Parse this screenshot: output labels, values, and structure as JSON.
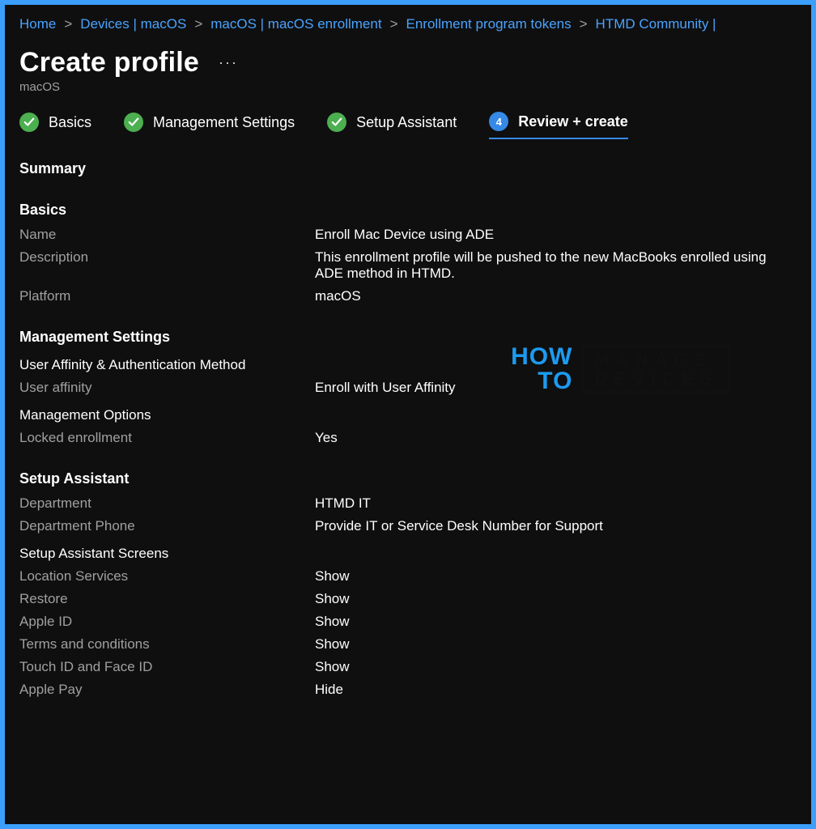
{
  "breadcrumb": [
    {
      "label": "Home"
    },
    {
      "label": "Devices | macOS"
    },
    {
      "label": "macOS | macOS enrollment"
    },
    {
      "label": "Enrollment program tokens"
    },
    {
      "label": "HTMD Community |"
    }
  ],
  "header": {
    "title": "Create profile",
    "subtitle": "macOS",
    "more": "···"
  },
  "steps": [
    {
      "label": "Basics",
      "state": "done"
    },
    {
      "label": "Management Settings",
      "state": "done"
    },
    {
      "label": "Setup Assistant",
      "state": "done"
    },
    {
      "label": "Review + create",
      "state": "active",
      "num": "4"
    }
  ],
  "summary_heading": "Summary",
  "sections": {
    "basics": {
      "heading": "Basics",
      "rows": [
        {
          "k": "Name",
          "v": "Enroll Mac Device using ADE"
        },
        {
          "k": "Description",
          "v": "This enrollment profile will be pushed to the new MacBooks enrolled using ADE method in HTMD."
        },
        {
          "k": "Platform",
          "v": "macOS"
        }
      ]
    },
    "mgmt": {
      "heading": "Management Settings",
      "sub1": "User Affinity & Authentication Method",
      "rows1": [
        {
          "k": "User affinity",
          "v": "Enroll with User Affinity"
        }
      ],
      "sub2": "Management Options",
      "rows2": [
        {
          "k": "Locked enrollment",
          "v": "Yes"
        }
      ]
    },
    "setup": {
      "heading": "Setup Assistant",
      "rows1": [
        {
          "k": "Department",
          "v": "HTMD IT"
        },
        {
          "k": "Department Phone",
          "v": "Provide IT or Service Desk Number for Support"
        }
      ],
      "sub1": "Setup Assistant Screens",
      "rows2": [
        {
          "k": "Location Services",
          "v": "Show"
        },
        {
          "k": "Restore",
          "v": "Show"
        },
        {
          "k": "Apple ID",
          "v": "Show"
        },
        {
          "k": "Terms and conditions",
          "v": "Show"
        },
        {
          "k": "Touch ID and Face ID",
          "v": "Show"
        },
        {
          "k": "Apple Pay",
          "v": "Hide"
        }
      ]
    }
  },
  "watermark": {
    "l1": "HOW",
    "l2": "TO",
    "r1": "MANAGE",
    "r2": "DEVICES"
  }
}
